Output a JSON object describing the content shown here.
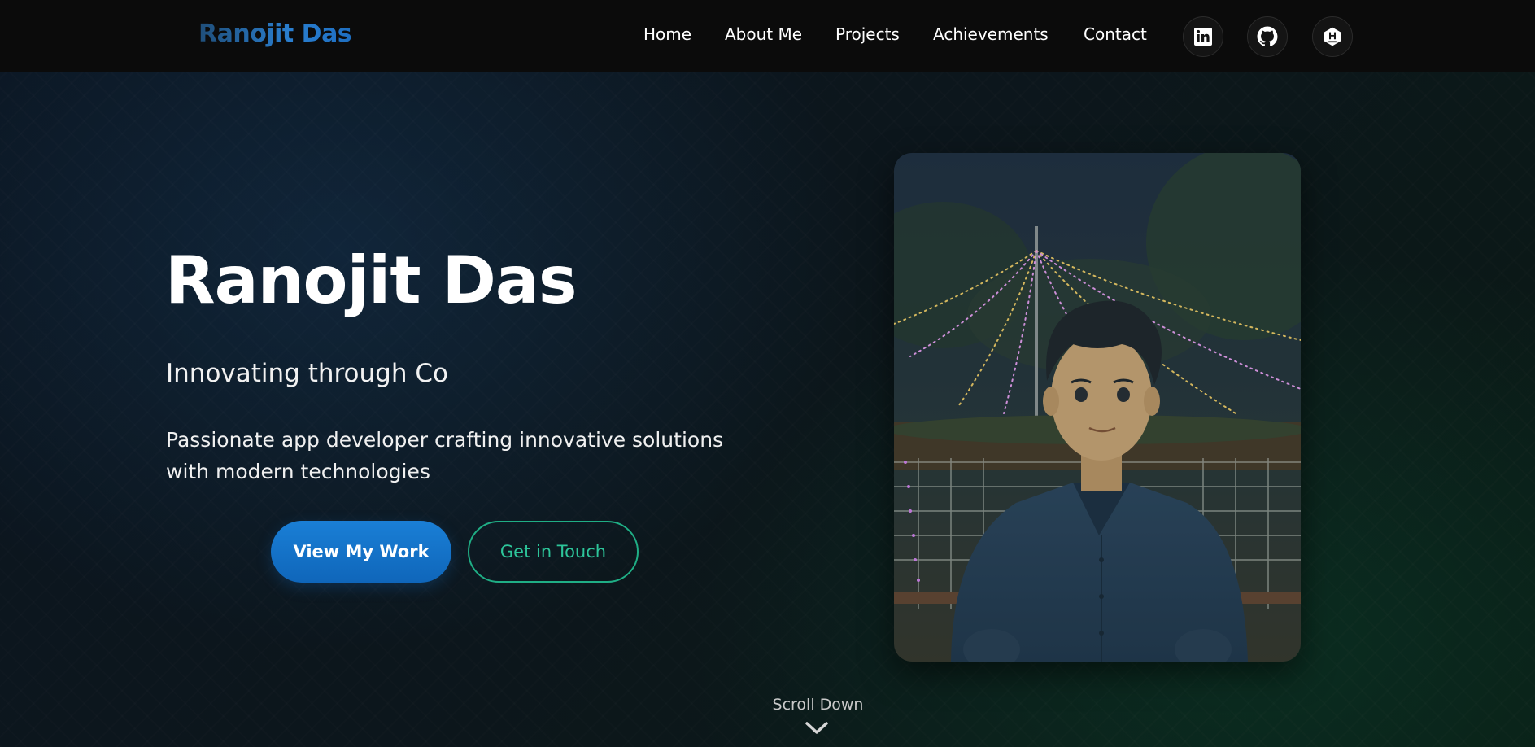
{
  "navbar": {
    "logo": "Ranojit Das",
    "links": [
      {
        "label": "Home"
      },
      {
        "label": "About Me"
      },
      {
        "label": "Projects"
      },
      {
        "label": "Achievements"
      },
      {
        "label": "Contact"
      }
    ],
    "social_icons": [
      "linkedin-icon",
      "github-icon",
      "hashnode-icon"
    ]
  },
  "hero": {
    "name": "Ranojit Das",
    "tagline": "Innovating through Co",
    "description": "Passionate app developer crafting innovative solutions with modern technologies",
    "primary_button": "View My Work",
    "secondary_button": "Get in Touch",
    "scroll_label": "Scroll Down"
  },
  "colors": {
    "background": "#0a0a0a",
    "accent_blue": "#1a7fd6",
    "accent_green": "#2dc59a",
    "text": "#ffffff"
  }
}
